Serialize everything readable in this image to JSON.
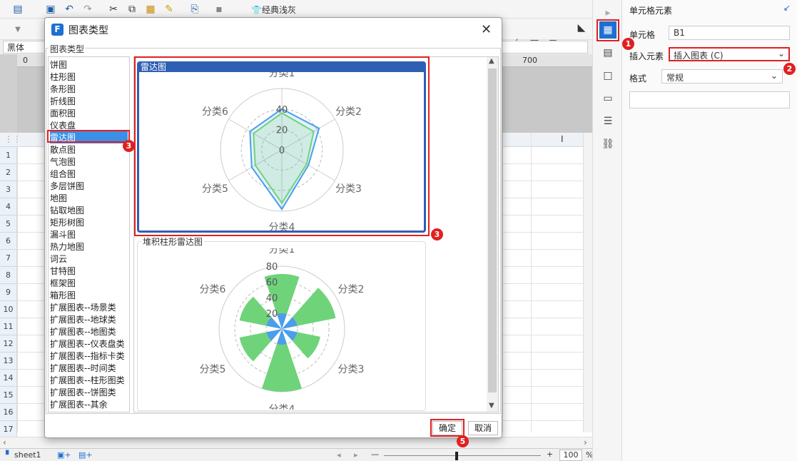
{
  "toolbar": {
    "theme_label": "经典浅灰",
    "font_name": "黑体",
    "ruler_700": "700",
    "ruler_0": "0"
  },
  "sheet": {
    "rows": [
      "1",
      "2",
      "3",
      "4",
      "5",
      "6",
      "7",
      "8",
      "9",
      "10",
      "11",
      "12",
      "13",
      "14",
      "15",
      "16",
      "17"
    ],
    "tab": "sheet1",
    "zoom": "100",
    "cursor": "I"
  },
  "panel": {
    "title": "单元格元素",
    "cell_label": "单元格",
    "cell_value": "B1",
    "insert_label": "插入元素",
    "insert_value": "插入图表 (C)",
    "format_label": "格式",
    "format_value": "常规"
  },
  "dialog": {
    "title": "图表类型",
    "group_label": "图表类型",
    "chart_types": [
      "饼图",
      "柱形图",
      "条形图",
      "折线图",
      "面积图",
      "仪表盘",
      "雷达图",
      "散点图",
      "气泡图",
      "组合图",
      "多层饼图",
      "地图",
      "钻取地图",
      "矩形树图",
      "漏斗图",
      "热力地图",
      "词云",
      "甘特图",
      "框架图",
      "箱形图",
      "扩展图表--场景类",
      "扩展图表--地球类",
      "扩展图表--地图类",
      "扩展图表--仪表盘类",
      "扩展图表--指标卡类",
      "扩展图表--时间类",
      "扩展图表--柱形图类",
      "扩展图表--饼图类",
      "扩展图表--其余"
    ],
    "selected_index": 6,
    "ok": "确定",
    "cancel": "取消"
  },
  "badges": [
    "1",
    "2",
    "3",
    "3",
    "5"
  ],
  "colors": {
    "accent": "#2f5fb4",
    "highlight": "#e02020",
    "series_blue": "#4a9eea",
    "series_green": "#6fd37a"
  },
  "chart_data": [
    {
      "type": "radar",
      "title": "雷达图",
      "categories": [
        "分类1",
        "分类2",
        "分类3",
        "分类4",
        "分类5",
        "分类6"
      ],
      "rlim": [
        0,
        40
      ],
      "ticks": [
        "0",
        "20",
        "40"
      ],
      "series": [
        {
          "values": [
            40,
            42,
            30,
            58,
            34,
            36
          ]
        },
        {
          "values": [
            36,
            36,
            28,
            52,
            30,
            32
          ]
        }
      ]
    },
    {
      "type": "stacked-polar-bar",
      "title": "堆积柱形雷达图",
      "categories": [
        "分类1",
        "分类2",
        "分类3",
        "分类4",
        "分类5",
        "分类6"
      ],
      "rlim": [
        0,
        80
      ],
      "ticks": [
        "20",
        "40",
        "60",
        "80"
      ],
      "series": [
        {
          "values": [
            20,
            20,
            20,
            20,
            20,
            20
          ]
        },
        {
          "values": [
            50,
            50,
            30,
            60,
            35,
            35
          ]
        }
      ]
    }
  ]
}
